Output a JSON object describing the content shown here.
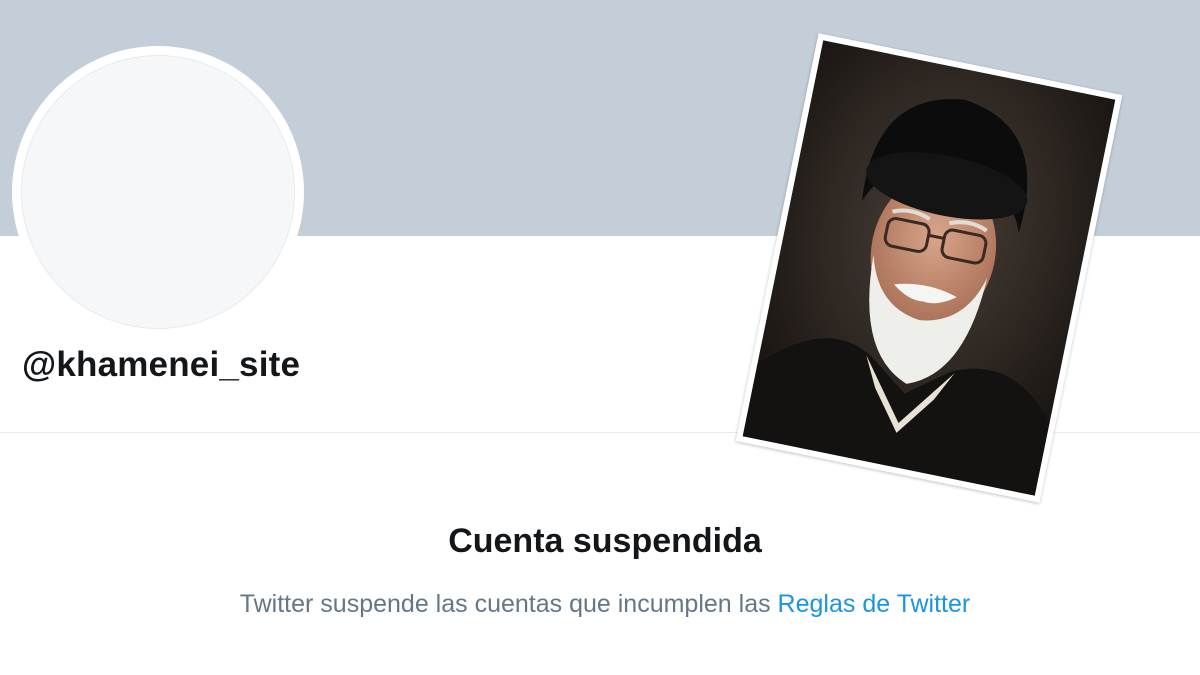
{
  "profile": {
    "handle": "@khamenei_site"
  },
  "photo": {
    "subject_icon": "portrait-photo"
  },
  "suspension": {
    "title": "Cuenta suspendida",
    "message": "Twitter suspende las cuentas que incumplen las",
    "link_label": "Reglas de Twitter"
  },
  "colors": {
    "banner": "#c4ced8",
    "text": "#14171a",
    "muted": "#657786",
    "link": "#1b95e0"
  }
}
